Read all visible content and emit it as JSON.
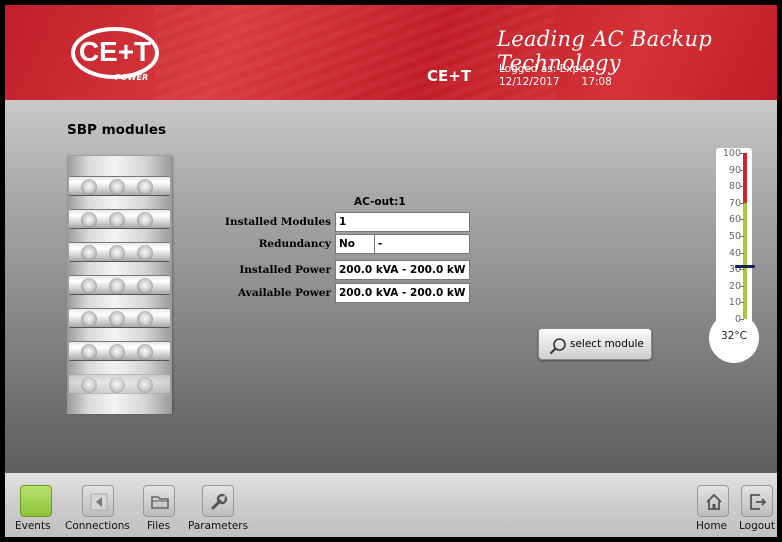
{
  "header": {
    "logo_text": "CE+T",
    "logo_power": "POWER",
    "brand": "CE+T",
    "tagline": "Leading AC Backup Technology",
    "logged_as": "Logged as: Expert",
    "date": "12/12/2017",
    "time": "17:08"
  },
  "page": {
    "title": "SBP modules"
  },
  "rack": {
    "module_count": 7,
    "populated": 6
  },
  "ac_info": {
    "title": "AC-out:1",
    "installed_modules_label": "Installed Modules",
    "installed_modules_value": "1",
    "redundancy_label": "Redundancy",
    "redundancy_value": "No",
    "redundancy_extra": "-",
    "installed_power_label": "Installed Power",
    "installed_power_value": "200.0 kVA - 200.0 kW",
    "available_power_label": "Available Power",
    "available_power_value": "200.0 kVA - 200.0 kW"
  },
  "select_module": {
    "label": "select module",
    "icon": "magnifier-icon"
  },
  "thermometer": {
    "scale": [
      "100",
      "90",
      "80",
      "70",
      "60",
      "50",
      "40",
      "30",
      "20",
      "10",
      "0"
    ],
    "value": "32°C",
    "level": 32,
    "red_from": 70,
    "colors": {
      "red": "#d4232b",
      "green": "#a7c63a"
    }
  },
  "footer": {
    "events": "Events",
    "connections": "Connections",
    "files": "Files",
    "parameters": "Parameters",
    "home": "Home",
    "logout": "Logout"
  },
  "colors": {
    "header_red": "#c8222c",
    "events_active": "#9ccc45"
  }
}
